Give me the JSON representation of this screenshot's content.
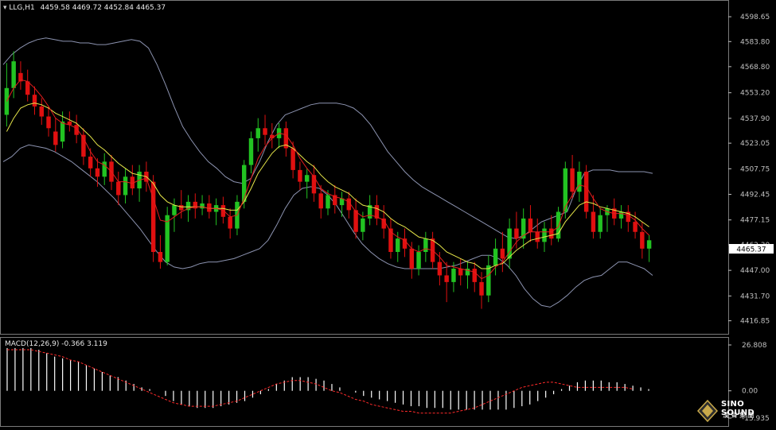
{
  "price_header": {
    "symbol_tf": "LLG,H1",
    "ohlc": "4459.58 4469.72 4452.84 4465.37"
  },
  "macd_header": "MACD(12,26,9) -0.366 3.119",
  "current_price_label": "4465.37",
  "brand": {
    "name": "SINO SOUND",
    "chinese": "漢 聲 集 團"
  },
  "colors": {
    "background": "#000000",
    "bull": "#22c322",
    "bear": "#e01010",
    "ma_fast": "#e21e1e",
    "ma_slow": "#e8e84a",
    "bands": "#8c93b0",
    "axis": "#c0c0c0",
    "macd_hist": "#ffffff",
    "macd_signal": "#ff2a2a"
  },
  "chart_data": [
    {
      "type": "candlestick",
      "title": "LLG,H1",
      "ylim": [
        4410,
        4602
      ],
      "y_ticks": [
        "4598.65",
        "4583.80",
        "4568.80",
        "4553.20",
        "4537.90",
        "4523.05",
        "4507.75",
        "4492.45",
        "4477.15",
        "4462.30",
        "4447.00",
        "4431.70",
        "4416.85"
      ],
      "candles": [
        [
          4540,
          4571,
          4533,
          4556
        ],
        [
          4556,
          4578,
          4550,
          4572
        ],
        [
          4565,
          4572,
          4555,
          4560
        ],
        [
          4560,
          4567,
          4548,
          4552
        ],
        [
          4552,
          4557,
          4540,
          4545
        ],
        [
          4545,
          4550,
          4534,
          4539
        ],
        [
          4539,
          4545,
          4527,
          4532
        ],
        [
          4530,
          4538,
          4518,
          4522
        ],
        [
          4524,
          4542,
          4520,
          4536
        ],
        [
          4536,
          4542,
          4530,
          4534
        ],
        [
          4534,
          4540,
          4523,
          4528
        ],
        [
          4528,
          4532,
          4510,
          4515
        ],
        [
          4515,
          4520,
          4503,
          4508
        ],
        [
          4508,
          4514,
          4497,
          4503
        ],
        [
          4503,
          4517,
          4498,
          4512
        ],
        [
          4512,
          4516,
          4495,
          4500
        ],
        [
          4500,
          4506,
          4486,
          4492
        ],
        [
          4492,
          4508,
          4487,
          4503
        ],
        [
          4503,
          4510,
          4492,
          4496
        ],
        [
          4496,
          4510,
          4488,
          4506
        ],
        [
          4506,
          4512,
          4494,
          4500
        ],
        [
          4500,
          4504,
          4452,
          4458
        ],
        [
          4458,
          4468,
          4448,
          4452
        ],
        [
          4452,
          4485,
          4450,
          4480
        ],
        [
          4480,
          4490,
          4470,
          4486
        ],
        [
          4486,
          4495,
          4478,
          4483
        ],
        [
          4483,
          4492,
          4476,
          4488
        ],
        [
          4488,
          4493,
          4478,
          4484
        ],
        [
          4484,
          4492,
          4480,
          4487
        ],
        [
          4487,
          4492,
          4478,
          4482
        ],
        [
          4482,
          4490,
          4474,
          4486
        ],
        [
          4486,
          4491,
          4475,
          4479
        ],
        [
          4479,
          4484,
          4466,
          4472
        ],
        [
          4472,
          4492,
          4468,
          4488
        ],
        [
          4488,
          4513,
          4484,
          4510
        ],
        [
          4510,
          4530,
          4505,
          4526
        ],
        [
          4526,
          4538,
          4518,
          4532
        ],
        [
          4532,
          4540,
          4522,
          4528
        ],
        [
          4528,
          4535,
          4520,
          4526
        ],
        [
          4526,
          4535,
          4520,
          4532
        ],
        [
          4532,
          4536,
          4515,
          4520
        ],
        [
          4520,
          4524,
          4502,
          4507
        ],
        [
          4507,
          4512,
          4495,
          4500
        ],
        [
          4500,
          4508,
          4490,
          4504
        ],
        [
          4504,
          4510,
          4488,
          4493
        ],
        [
          4493,
          4498,
          4478,
          4484
        ],
        [
          4484,
          4495,
          4480,
          4492
        ],
        [
          4492,
          4498,
          4481,
          4486
        ],
        [
          4486,
          4494,
          4479,
          4490
        ],
        [
          4490,
          4494,
          4478,
          4483
        ],
        [
          4483,
          4490,
          4466,
          4470
        ],
        [
          4470,
          4482,
          4465,
          4478
        ],
        [
          4478,
          4492,
          4474,
          4486
        ],
        [
          4486,
          4492,
          4474,
          4478
        ],
        [
          4478,
          4486,
          4466,
          4472
        ],
        [
          4472,
          4478,
          4454,
          4458
        ],
        [
          4458,
          4470,
          4452,
          4466
        ],
        [
          4466,
          4472,
          4455,
          4460
        ],
        [
          4460,
          4464,
          4442,
          4448
        ],
        [
          4448,
          4462,
          4444,
          4458
        ],
        [
          4458,
          4470,
          4452,
          4466
        ],
        [
          4466,
          4470,
          4448,
          4452
        ],
        [
          4452,
          4458,
          4438,
          4444
        ],
        [
          4444,
          4452,
          4428,
          4440
        ],
        [
          4440,
          4452,
          4434,
          4448
        ],
        [
          4448,
          4454,
          4438,
          4444
        ],
        [
          4444,
          4452,
          4436,
          4448
        ],
        [
          4448,
          4452,
          4434,
          4440
        ],
        [
          4440,
          4446,
          4424,
          4432
        ],
        [
          4432,
          4456,
          4428,
          4450
        ],
        [
          4450,
          4466,
          4444,
          4460
        ],
        [
          4460,
          4470,
          4446,
          4454
        ],
        [
          4454,
          4478,
          4448,
          4472
        ],
        [
          4472,
          4482,
          4460,
          4466
        ],
        [
          4466,
          4484,
          4460,
          4478
        ],
        [
          4478,
          4486,
          4464,
          4470
        ],
        [
          4470,
          4478,
          4460,
          4464
        ],
        [
          4464,
          4476,
          4458,
          4472
        ],
        [
          4472,
          4480,
          4462,
          4466
        ],
        [
          4466,
          4485,
          4464,
          4482
        ],
        [
          4482,
          4512,
          4478,
          4508
        ],
        [
          4508,
          4516,
          4490,
          4494
        ],
        [
          4494,
          4512,
          4488,
          4506
        ],
        [
          4506,
          4510,
          4478,
          4482
        ],
        [
          4482,
          4492,
          4466,
          4470
        ],
        [
          4470,
          4484,
          4466,
          4480
        ],
        [
          4480,
          4486,
          4470,
          4484
        ],
        [
          4484,
          4490,
          4474,
          4478
        ],
        [
          4478,
          4486,
          4472,
          4482
        ],
        [
          4482,
          4486,
          4470,
          4476
        ],
        [
          4476,
          4482,
          4466,
          4470
        ],
        [
          4470,
          4476,
          4454,
          4460
        ],
        [
          4460,
          4468,
          4452,
          4465
        ]
      ],
      "ma_fast": [
        4548,
        4556,
        4561,
        4560,
        4556,
        4551,
        4545,
        4538,
        4535,
        4534,
        4532,
        4526,
        4518,
        4512,
        4510,
        4506,
        4500,
        4500,
        4499,
        4501,
        4502,
        4490,
        4477,
        4476,
        4479,
        4482,
        4484,
        4485,
        4485,
        4484,
        4484,
        4483,
        4479,
        4480,
        4490,
        4502,
        4514,
        4521,
        4526,
        4529,
        4528,
        4522,
        4514,
        4508,
        4503,
        4496,
        4493,
        4491,
        4490,
        4488,
        4482,
        4479,
        4480,
        4479,
        4477,
        4470,
        4467,
        4465,
        4460,
        4458,
        4460,
        4459,
        4455,
        4450,
        4449,
        4448,
        4447,
        4446,
        4442,
        4444,
        4449,
        4452,
        4458,
        4464,
        4468,
        4470,
        4470,
        4470,
        4470,
        4473,
        4485,
        4492,
        4498,
        4497,
        4490,
        4484,
        4482,
        4481,
        4481,
        4480,
        4477,
        4472,
        4468
      ],
      "ma_slow": [
        4530,
        4538,
        4544,
        4546,
        4547,
        4546,
        4544,
        4541,
        4539,
        4537,
        4535,
        4531,
        4527,
        4522,
        4519,
        4515,
        4511,
        4508,
        4505,
        4504,
        4503,
        4499,
        4492,
        4488,
        4486,
        4485,
        4485,
        4485,
        4485,
        4484,
        4484,
        4484,
        4483,
        4483,
        4488,
        4496,
        4505,
        4511,
        4517,
        4521,
        4522,
        4520,
        4516,
        4512,
        4509,
        4504,
        4500,
        4497,
        4495,
        4493,
        4489,
        4486,
        4485,
        4484,
        4482,
        4478,
        4475,
        4473,
        4470,
        4467,
        4466,
        4465,
        4462,
        4458,
        4456,
        4454,
        4452,
        4451,
        4448,
        4448,
        4450,
        4451,
        4455,
        4459,
        4462,
        4465,
        4466,
        4467,
        4468,
        4469,
        4476,
        4481,
        4486,
        4488,
        4487,
        4485,
        4484,
        4483,
        4482,
        4481,
        4479,
        4476,
        4473
      ],
      "upper_band": [
        4570,
        4576,
        4580,
        4583,
        4585,
        4586,
        4585,
        4584,
        4584,
        4583,
        4583,
        4582,
        4582,
        4583,
        4584,
        4585,
        4584,
        4580,
        4570,
        4558,
        4545,
        4533,
        4525,
        4518,
        4512,
        4508,
        4503,
        4500,
        4499,
        4502,
        4512,
        4524,
        4534,
        4540,
        4542,
        4544,
        4546,
        4547,
        4547,
        4547,
        4546,
        4544,
        4540,
        4534,
        4526,
        4518,
        4512,
        4506,
        4501,
        4497,
        4494,
        4491,
        4488,
        4485,
        4482,
        4479,
        4476,
        4473,
        4470,
        4467,
        4466,
        4468,
        4472,
        4476,
        4478,
        4480,
        4482,
        4495,
        4505,
        4507,
        4507,
        4507,
        4506,
        4506,
        4506,
        4506,
        4505
      ],
      "lower_band": [
        4512,
        4515,
        4520,
        4522,
        4521,
        4520,
        4518,
        4515,
        4512,
        4508,
        4504,
        4500,
        4495,
        4490,
        4484,
        4478,
        4472,
        4465,
        4458,
        4452,
        4449,
        4448,
        4449,
        4451,
        4452,
        4452,
        4453,
        4454,
        4456,
        4458,
        4460,
        4465,
        4474,
        4484,
        4492,
        4496,
        4497,
        4496,
        4492,
        4486,
        4478,
        4470,
        4463,
        4458,
        4454,
        4451,
        4449,
        4448,
        4448,
        4448,
        4448,
        4448,
        4449,
        4450,
        4452,
        4454,
        4456,
        4456,
        4454,
        4450,
        4444,
        4436,
        4430,
        4426,
        4425,
        4428,
        4432,
        4437,
        4441,
        4443,
        4444,
        4448,
        4452,
        4452,
        4450,
        4448,
        4444
      ]
    },
    {
      "type": "bar",
      "title": "MACD(12,26,9)",
      "ylim": [
        -15.935,
        26.808
      ],
      "y_ticks": [
        "26.808",
        "0.00",
        "-15.935"
      ],
      "histogram": [
        25,
        25,
        25,
        25,
        24,
        22,
        20,
        19,
        18,
        17,
        15,
        13,
        11,
        9,
        8,
        6,
        4,
        2,
        1,
        0,
        -3,
        -6,
        -8,
        -9,
        -10,
        -10,
        -10,
        -9,
        -8,
        -7,
        -6,
        -4,
        -2,
        1,
        4,
        6,
        8,
        8,
        8,
        7,
        6,
        4,
        2,
        0,
        -1,
        -3,
        -4,
        -5,
        -6,
        -7,
        -8,
        -9,
        -9,
        -10,
        -10,
        -10,
        -11,
        -11,
        -11,
        -11,
        -11,
        -11,
        -11,
        -11,
        -10,
        -9,
        -8,
        -6,
        -4,
        -2,
        1,
        3,
        5,
        6,
        6,
        6,
        5,
        5,
        4,
        3,
        2,
        1
      ],
      "signal": [
        24,
        24,
        24,
        24,
        23,
        22,
        21,
        20,
        18,
        17,
        15,
        13,
        11,
        9,
        7,
        5,
        3,
        1,
        -1,
        -3,
        -5,
        -7,
        -8,
        -9,
        -9,
        -9,
        -9,
        -8,
        -7,
        -6,
        -4,
        -2,
        0,
        2,
        4,
        5,
        6,
        6,
        5,
        4,
        2,
        0,
        -1,
        -3,
        -5,
        -6,
        -8,
        -9,
        -10,
        -11,
        -12,
        -12,
        -13,
        -13,
        -13,
        -13,
        -13,
        -12,
        -11,
        -10,
        -8,
        -6,
        -4,
        -2,
        0,
        2,
        3,
        4,
        5,
        5,
        4,
        3,
        2,
        2,
        2,
        2,
        2,
        2,
        2,
        1
      ]
    }
  ]
}
